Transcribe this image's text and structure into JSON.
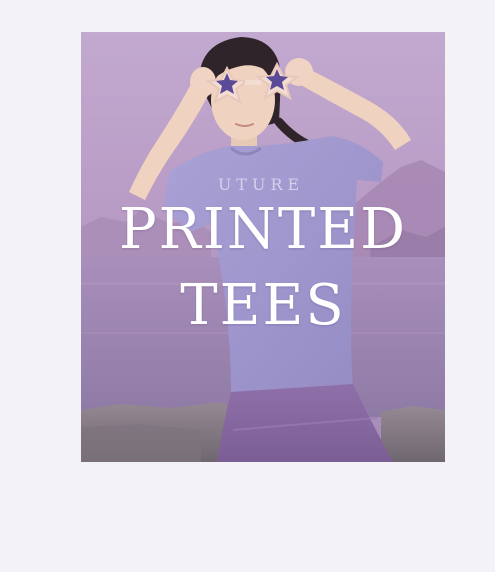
{
  "banner": {
    "title_line1": "PRINTED",
    "title_line2": "TEES",
    "shirt_print": "UTURE"
  },
  "colors": {
    "page_background": "#f3f3f7",
    "sky": "#bba3c9",
    "water": "#9b82b0",
    "rocks": "#8a8088",
    "tee": "#a49ad0",
    "skirt": "#8a6aa4",
    "title_text": "#ffffff"
  }
}
